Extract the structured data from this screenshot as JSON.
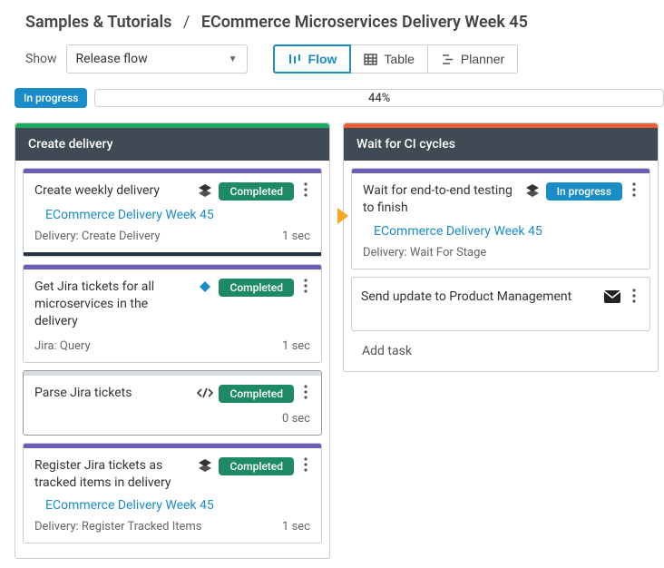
{
  "breadcrumb": {
    "parent": "Samples & Tutorials",
    "current": "ECommerce Microservices Delivery Week 45"
  },
  "toolbar": {
    "show_label": "Show",
    "select_value": "Release flow",
    "flow_label": "Flow",
    "table_label": "Table",
    "planner_label": "Planner"
  },
  "progress": {
    "status": "In progress",
    "percent": "44%"
  },
  "columns": [
    {
      "title": "Create delivery",
      "accent": "green",
      "tasks": [
        {
          "title": "Create weekly delivery",
          "icon": "stack",
          "status": "Completed",
          "link": "ECommerce Delivery Week 45",
          "footer_left": "Delivery: Create Delivery",
          "footer_right": "1 sec",
          "divider": true
        },
        {
          "title": "Get Jira tickets for all microservices in the delivery",
          "icon": "jira",
          "status": "Completed",
          "footer_left": "Jira: Query",
          "footer_right": "1 sec"
        },
        {
          "title": "Parse Jira tickets",
          "icon": "code",
          "status": "Completed",
          "footer_left": "",
          "footer_right": "0 sec",
          "gray_accent": true
        },
        {
          "title": "Register Jira tickets as tracked items in delivery",
          "icon": "stack",
          "status": "Completed",
          "link": "ECommerce Delivery Week 45",
          "footer_left": "Delivery: Register Tracked Items",
          "footer_right": "1 sec"
        }
      ]
    },
    {
      "title": "Wait for CI cycles",
      "accent": "orange",
      "tasks": [
        {
          "title": "Wait for end-to-end testing to finish",
          "icon": "stack",
          "status": "In progress",
          "link": "ECommerce Delivery Week 45",
          "footer_left": "Delivery: Wait For Stage",
          "footer_right": "",
          "play_marker": true
        }
      ],
      "simple_task": {
        "title": "Send update to Product Management"
      },
      "add_task": "Add task"
    }
  ]
}
